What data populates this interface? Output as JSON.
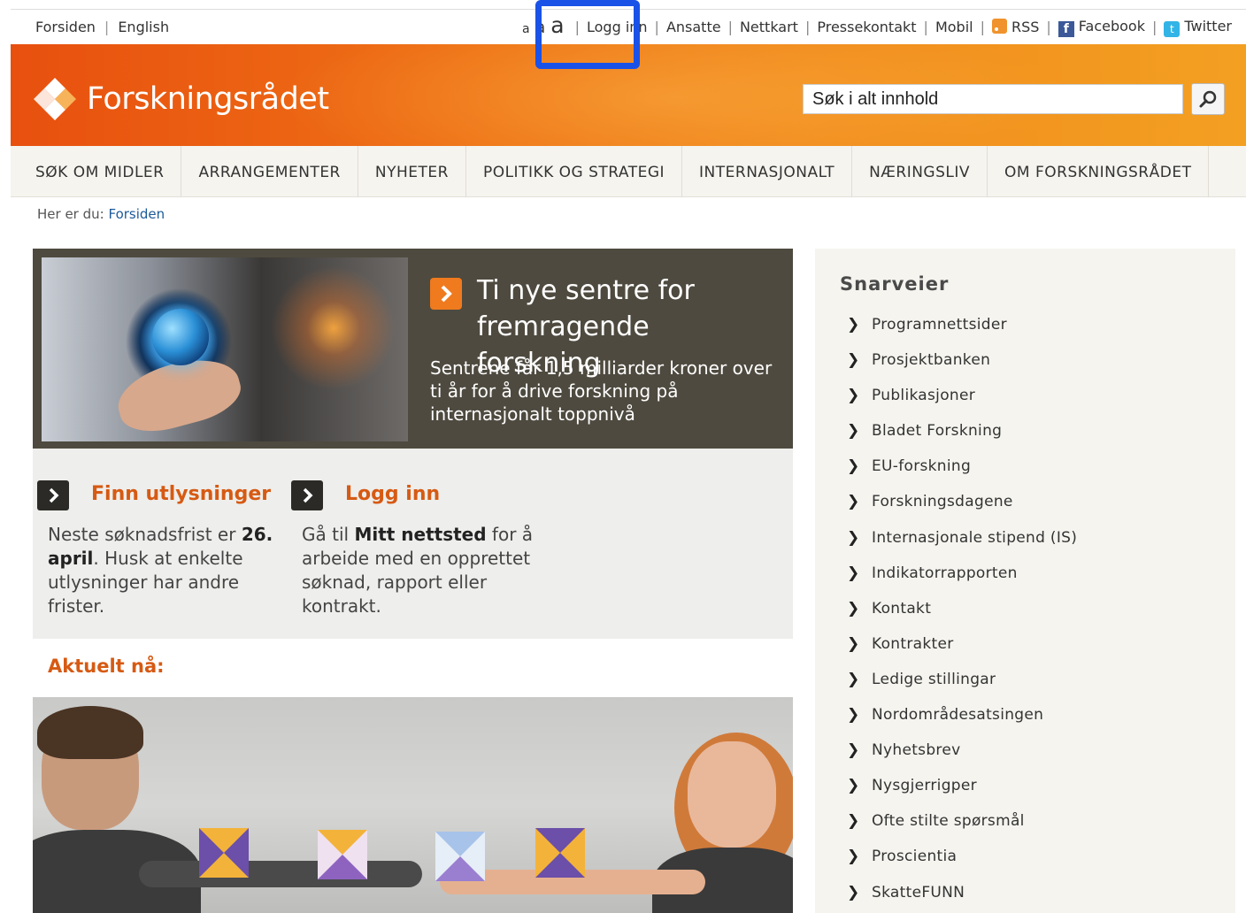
{
  "topbar": {
    "left_links": [
      "Forsiden",
      "English"
    ],
    "font_size_labels": [
      "a",
      "a",
      "a"
    ],
    "right_links": [
      "Logg inn",
      "Ansatte",
      "Nettkart",
      "Pressekontakt",
      "Mobil"
    ],
    "rss_label": "RSS",
    "facebook_label": "Facebook",
    "twitter_label": "Twitter"
  },
  "header": {
    "logo_text": "Forskningsrådet",
    "search_value": "Søk i alt innhold"
  },
  "nav": {
    "items": [
      "SØK OM MIDLER",
      "ARRANGEMENTER",
      "NYHETER",
      "POLITIKK OG STRATEGI",
      "INTERNASJONALT",
      "NÆRINGSLIV",
      "OM FORSKNINGSRÅDET"
    ]
  },
  "breadcrumb": {
    "prefix": "Her er du:",
    "current": "Forsiden"
  },
  "feature": {
    "title": "Ti nye sentre for fremragende forskning",
    "text": "Sentrene får 1,5 milliarder kroner over ti år for å drive forskning på internasjonalt toppnivå"
  },
  "promos": [
    {
      "title": "Finn utlysninger",
      "body_pre": "Neste søknadsfrist er ",
      "body_bold": "26. april",
      "body_post": ". Husk at enkelte utlysninger har andre frister."
    },
    {
      "title": "Logg inn",
      "body_pre": "Gå til ",
      "body_bold": "Mitt nettsted",
      "body_post": " for å arbeide med en opprettet søknad, rapport eller kontrakt."
    }
  ],
  "aktuelt_heading": "Aktuelt nå:",
  "sidebar": {
    "heading": "Snarveier",
    "items": [
      "Programnettsider",
      "Prosjektbanken",
      "Publikasjoner",
      "Bladet Forskning",
      "EU-forskning",
      "Forskningsdagene",
      "Internasjonale stipend (IS)",
      "Indikatorrapporten",
      "Kontakt",
      "Kontrakter",
      "Ledige stillingar",
      "Nordområdesatsingen",
      "Nyhetsbrev",
      "Nysgjerrigper",
      "Ofte stilte spørsmål",
      "Proscientia",
      "SkatteFUNN"
    ]
  },
  "colors": {
    "accent_orange": "#d65a13",
    "header_orange": "#ee6f15",
    "highlight_blue": "#1a52e8",
    "feature_bg": "#4e4a3f"
  }
}
